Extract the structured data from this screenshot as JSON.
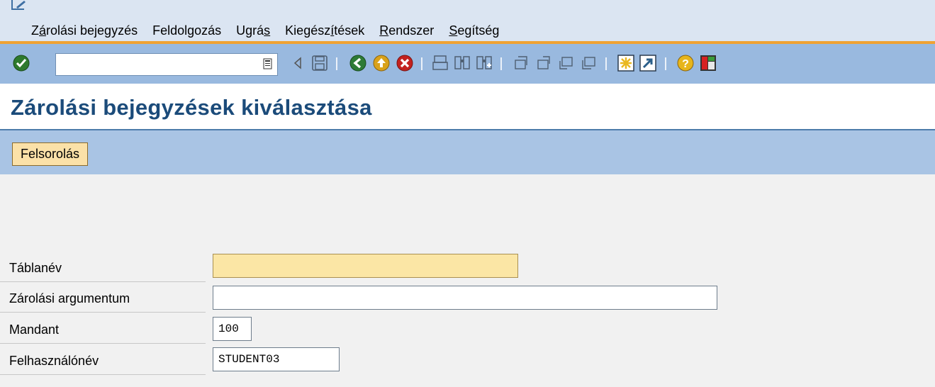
{
  "menu": {
    "items": [
      {
        "before": "Z",
        "underline": "á",
        "after": "rolási bejegyzés"
      },
      {
        "before": "Feldolgozás",
        "underline": "",
        "after": ""
      },
      {
        "before": "Ugrá",
        "underline": "s",
        "after": ""
      },
      {
        "before": "Kiegész",
        "underline": "í",
        "after": "tések"
      },
      {
        "before": "",
        "underline": "R",
        "after": "endszer"
      },
      {
        "before": "",
        "underline": "S",
        "after": "egítség"
      }
    ]
  },
  "toolbar": {
    "command_value": "",
    "icons": [
      "enter-icon",
      "command-history-icon",
      "back-arrow-icon",
      "save-icon",
      "back-icon",
      "exit-icon",
      "cancel-icon",
      "print-icon",
      "find-icon",
      "find-next-icon",
      "first-page-icon",
      "previous-page-icon",
      "next-page-icon",
      "last-page-icon",
      "new-session-icon",
      "shortcut-icon",
      "help-icon",
      "layout-icon"
    ]
  },
  "page": {
    "title": "Zárolási bejegyzések kiválasztása"
  },
  "app_toolbar": {
    "list_button": "Felsorolás"
  },
  "form": {
    "fields": [
      {
        "label": "Táblanév",
        "value": ""
      },
      {
        "label": "Zárolási argumentum",
        "value": ""
      },
      {
        "label": "Mandant",
        "value": "100"
      },
      {
        "label": "Felhasználónév",
        "value": "STUDENT03"
      }
    ]
  },
  "colors": {
    "menubar": "#dbe5f2",
    "toolbar": "#99b9df",
    "accent": "#f0a233",
    "title": "#1b4b7a",
    "button": "#fbe1a8",
    "required_field": "#fbe6a5"
  }
}
